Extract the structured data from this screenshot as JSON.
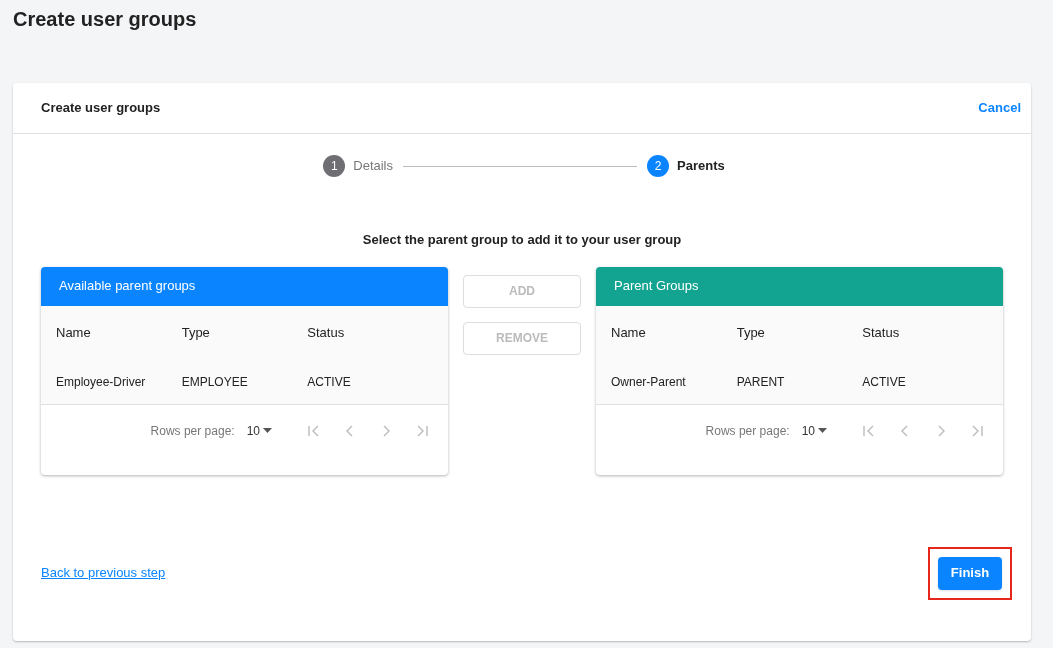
{
  "page_title": "Create user groups",
  "card": {
    "title": "Create user groups",
    "cancel": "Cancel"
  },
  "steps": [
    {
      "number": "1",
      "label": "Details",
      "selected": false
    },
    {
      "number": "2",
      "label": "Parents",
      "selected": true
    }
  ],
  "instruction": "Select the parent group to add it to your user group",
  "panels": [
    {
      "title": "Available parent groups",
      "color": "#0a84ff",
      "columns": [
        "Name",
        "Type",
        "Status"
      ],
      "rows": [
        [
          "Employee-Driver",
          "EMPLOYEE",
          "ACTIVE"
        ]
      ],
      "rows_per_page_label": "Rows per page:",
      "rows_per_page": "10"
    },
    {
      "title": "Parent Groups",
      "color": "#13a391",
      "columns": [
        "Name",
        "Type",
        "Status"
      ],
      "rows": [
        [
          "Owner-Parent",
          "PARENT",
          "ACTIVE"
        ]
      ],
      "rows_per_page_label": "Rows per page:",
      "rows_per_page": "10"
    }
  ],
  "transfer_buttons": [
    {
      "label": "ADD",
      "disabled": true
    },
    {
      "label": "REMOVE",
      "disabled": true
    }
  ],
  "back_link": "Back to previous step",
  "finish": {
    "label": "Finish",
    "highlighted": true
  }
}
